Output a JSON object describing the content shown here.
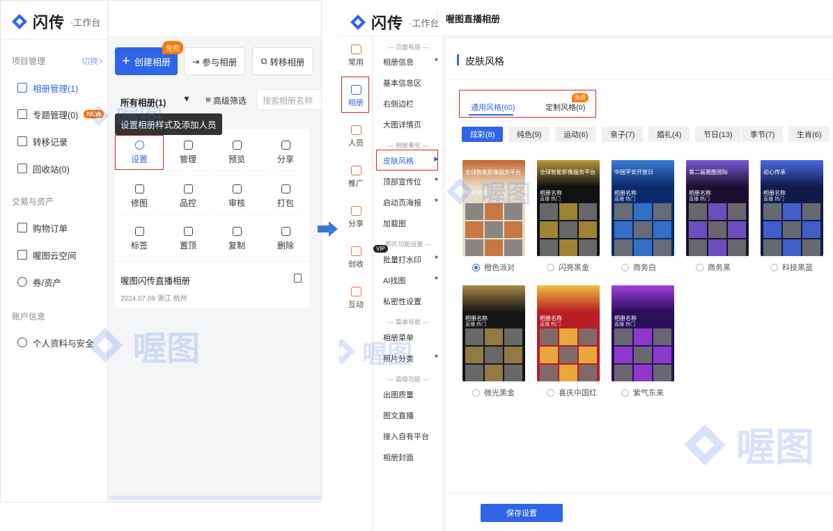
{
  "left": {
    "logo": {
      "name": "闪传",
      "sub": "·工作台"
    },
    "nav": {
      "section1": "项目管理",
      "switch_link": "切换>",
      "items1": [
        {
          "label": "相册管理(1)",
          "icon": "album-icon"
        },
        {
          "label": "专题管理(0)",
          "icon": "topic-icon",
          "badge": "NEW"
        },
        {
          "label": "转移记录",
          "icon": "transfer-icon"
        },
        {
          "label": "回收站(0)",
          "icon": "trash-icon"
        }
      ],
      "section2": "交易与资产",
      "items2": [
        {
          "label": "购物订单",
          "icon": "order-icon"
        },
        {
          "label": "喔图云空间",
          "icon": "cloud-icon"
        },
        {
          "label": "券/资产",
          "icon": "coupon-icon"
        }
      ],
      "section3": "账户信息",
      "items3": [
        {
          "label": "个人资料与安全",
          "icon": "user-icon"
        }
      ]
    },
    "toolbar": {
      "create_label": "创建相册",
      "free_badge": "免费",
      "join_label": "参与相册",
      "transfer_label": "转移相册"
    },
    "filter": {
      "all_label": "所有相册(1)",
      "advanced_label": "高级筛选",
      "search_placeholder": "搜索相册名称"
    },
    "tooltip": "设置相册样式及添加人员",
    "actions": [
      {
        "label": "设置",
        "icon": "settings-icon"
      },
      {
        "label": "管理",
        "icon": "upload-icon"
      },
      {
        "label": "预览",
        "icon": "preview-icon"
      },
      {
        "label": "分享",
        "icon": "share-icon"
      },
      {
        "label": "修图",
        "icon": "retouch-icon"
      },
      {
        "label": "品控",
        "icon": "shield-icon"
      },
      {
        "label": "审核",
        "icon": "review-icon"
      },
      {
        "label": "打包",
        "icon": "download-icon"
      },
      {
        "label": "标签",
        "icon": "tag-icon"
      },
      {
        "label": "置顶",
        "icon": "pin-top-icon"
      },
      {
        "label": "复制",
        "icon": "copy-icon"
      },
      {
        "label": "删除",
        "icon": "delete-icon"
      }
    ],
    "album": {
      "title": "喔图闪传直播相册",
      "meta": "2024.07.09 浙江 杭州"
    },
    "watermark": "喔图"
  },
  "right": {
    "logo": {
      "name": "闪传",
      "sub": "·工作台"
    },
    "page_title": "喔图直播相册",
    "rail": [
      {
        "label": "常用",
        "icon": "star-icon"
      },
      {
        "label": "相册",
        "icon": "album-icon"
      },
      {
        "label": "人员",
        "icon": "people-icon"
      },
      {
        "label": "推广",
        "icon": "promote-icon"
      },
      {
        "label": "分享",
        "icon": "share-icon"
      },
      {
        "label": "创收",
        "icon": "revenue-icon"
      },
      {
        "label": "互动",
        "icon": "interact-icon"
      }
    ],
    "menu": {
      "group1": "— 页面布局 —",
      "items1": [
        "相册信息",
        "基本信息区",
        "右侧边栏",
        "大图详情页"
      ],
      "group2": "— 相册美化 —",
      "items2": [
        "皮肤风格",
        "顶部宣传位",
        "启动页海报",
        "加载图"
      ],
      "group3": "照片功能设置 —",
      "vip": "VIP",
      "items3": [
        "批量打水印",
        "AI找图",
        "私密性设置"
      ],
      "group4": "— 菜单导航 —",
      "items4": [
        "相册菜单",
        "照片分类"
      ],
      "group5": "— 高级功能 —",
      "items5": [
        "出图质量",
        "图文直播",
        "接入自有平台",
        "相册封面"
      ]
    },
    "content": {
      "section_title": "皮肤风格",
      "tab_general": "通用风格(60)",
      "tab_custom": "定制风格(0)",
      "free_badge": "免费",
      "chips": [
        "炫彩(8)",
        "纯色(9)",
        "运动(6)",
        "亲子(7)",
        "婚礼(4)",
        "节日(13)",
        "季节(7)",
        "生肖(6)"
      ],
      "skins": [
        {
          "name": "橙色派对",
          "header": "全球智能影像服务平台",
          "theme": "#e9dcc4",
          "accent": "#c0662e",
          "selected": true
        },
        {
          "name": "闪亮黑金",
          "header": "全球智能影像服务平台",
          "theme": "#111111",
          "accent": "#b8983a",
          "selected": false
        },
        {
          "name": "商务白",
          "header": "中国平安开放日",
          "theme": "#0c2a6b",
          "accent": "#3a7bd5",
          "selected": false
        },
        {
          "name": "商务黑",
          "header": "第二届雅酷国际",
          "theme": "#1a1030",
          "accent": "#7a5ad6",
          "selected": false
        },
        {
          "name": "科技黑蓝",
          "header": "初心传承",
          "theme": "#101b4a",
          "accent": "#4a6adf",
          "selected": false
        },
        {
          "name": "微光黑金",
          "header": "",
          "theme": "#151515",
          "accent": "#a88a4a",
          "selected": false
        },
        {
          "name": "喜庆中国红",
          "header": "",
          "theme": "#b81d24",
          "accent": "#f0c040",
          "selected": false
        },
        {
          "name": "紫气东来",
          "header": "",
          "theme": "#2a0f5a",
          "accent": "#a040e0",
          "selected": false
        }
      ],
      "thumb_label": "相册名称",
      "thumb_tabs": "直播 热门",
      "save_label": "保存设置"
    },
    "watermark": "喔图"
  },
  "colors": {
    "brand": "#2f66e8",
    "highlight": "#e02020",
    "badge": "#ff7a00"
  }
}
